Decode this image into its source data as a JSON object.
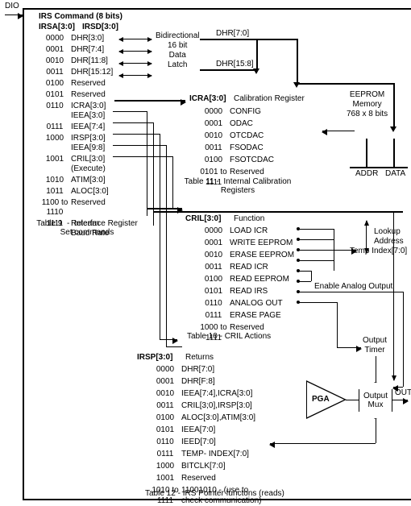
{
  "labels": {
    "dio": "DIO",
    "irs_cmd": "IRS Command (8 bits)",
    "irsa_hdr": "IRSA[3:0]",
    "irsd_hdr": "IRSD[3:0]",
    "bidi1": "Bidirectional",
    "bidi2": "16 bit",
    "bidi3": "Data",
    "bidi4": "Latch",
    "dhr70": "DHR[7:0]",
    "dhr158": "DHR[15:8]",
    "eeprom1": "EEPROM",
    "eeprom2": "Memory",
    "eeprom3": "768 x 8 bits",
    "addr": "ADDR",
    "data": "DATA",
    "icra_hdr": "ICRA[3:0]",
    "calreg": "Calibration Register",
    "lookup1": "Lookup",
    "lookup2": "Address",
    "lookup3": "Temp Index[7:0]",
    "enable": "Enable Analog Output",
    "output_timer": "Output\nTimer",
    "cril_hdr": "CRIL[3:0]",
    "cril_func": "Function",
    "irsp_hdr": "IRSP[3:0]",
    "returns": "Returns",
    "pga": "PGA",
    "mux": "Output\nMux",
    "out": "OUT",
    "tbl9": "Table 9  -  Interface Register\nSet commands",
    "tbl10": "Table 10 - CRIL Actions",
    "tbl11": "Table 11 -  Internal Calibration\nRegisters",
    "tbl12": "Table 12 - IRS Pointer functons (reads)"
  },
  "irsa": [
    {
      "c": "0000",
      "d": "DHR[3:0]"
    },
    {
      "c": "0001",
      "d": "DHR[7:4]"
    },
    {
      "c": "0010",
      "d": "DHR[11:8]"
    },
    {
      "c": "0011",
      "d": "DHR[15:12]"
    },
    {
      "c": "0100",
      "d": "Reserved"
    },
    {
      "c": "0101",
      "d": "Reserved"
    },
    {
      "c": "0110",
      "d": "ICRA[3:0]\nIEEA[3:0]"
    },
    {
      "c": "0111",
      "d": "IEEA[7:4]"
    },
    {
      "c": "1000",
      "d": "IRSP[3:0]\nIEEA[9:8]"
    },
    {
      "c": "1001",
      "d": "CRIL[3:0]\n(Execute)"
    },
    {
      "c": "1010",
      "d": "ATIM[3:0]"
    },
    {
      "c": "1011",
      "d": "ALOC[3:0]"
    },
    {
      "c": "1100 to\n1110",
      "d": "Reserved"
    },
    {
      "c": "1111",
      "d": "Relearn\nBaud Rate"
    }
  ],
  "icra": [
    {
      "c": "0000",
      "d": "CONFIG"
    },
    {
      "c": "0001",
      "d": "ODAC"
    },
    {
      "c": "0010",
      "d": "OTCDAC"
    },
    {
      "c": "0011",
      "d": "FSODAC"
    },
    {
      "c": "0100",
      "d": "FSOTCDAC"
    },
    {
      "c": "0101 to\n1111",
      "d": "Reserved"
    }
  ],
  "cril": [
    {
      "c": "0000",
      "d": "LOAD ICR"
    },
    {
      "c": "0001",
      "d": "WRITE EEPROM"
    },
    {
      "c": "0010",
      "d": "ERASE EEPROM"
    },
    {
      "c": "0011",
      "d": "READ ICR"
    },
    {
      "c": "0100",
      "d": "READ EEPROM"
    },
    {
      "c": "0101",
      "d": "READ IRS"
    },
    {
      "c": "0110",
      "d": "ANALOG OUT"
    },
    {
      "c": "0111",
      "d": "ERASE PAGE"
    },
    {
      "c": "1000 to\n1111",
      "d": "Reserved"
    }
  ],
  "irsp": [
    {
      "c": "0000",
      "d": "DHR[7:0]"
    },
    {
      "c": "0001",
      "d": "DHR[F:8]"
    },
    {
      "c": "0010",
      "d": "IEEA[7:4],ICRA[3:0]"
    },
    {
      "c": "0011",
      "d": "CRIL[3;0],IRSP[3:0]"
    },
    {
      "c": "0100",
      "d": "ALOC[3:0],ATIM[3:0]"
    },
    {
      "c": "0101",
      "d": "IEEA[7:0]"
    },
    {
      "c": "0110",
      "d": "IEED[7:0]"
    },
    {
      "c": "0111",
      "d": "TEMP- INDEX[7:0]"
    },
    {
      "c": "1000",
      "d": "BITCLK[7:0]"
    },
    {
      "c": "1001",
      "d": "Reserved"
    },
    {
      "c": "1010 to\n1111",
      "d": "11001010 - (use to\ncheck communication)"
    }
  ]
}
